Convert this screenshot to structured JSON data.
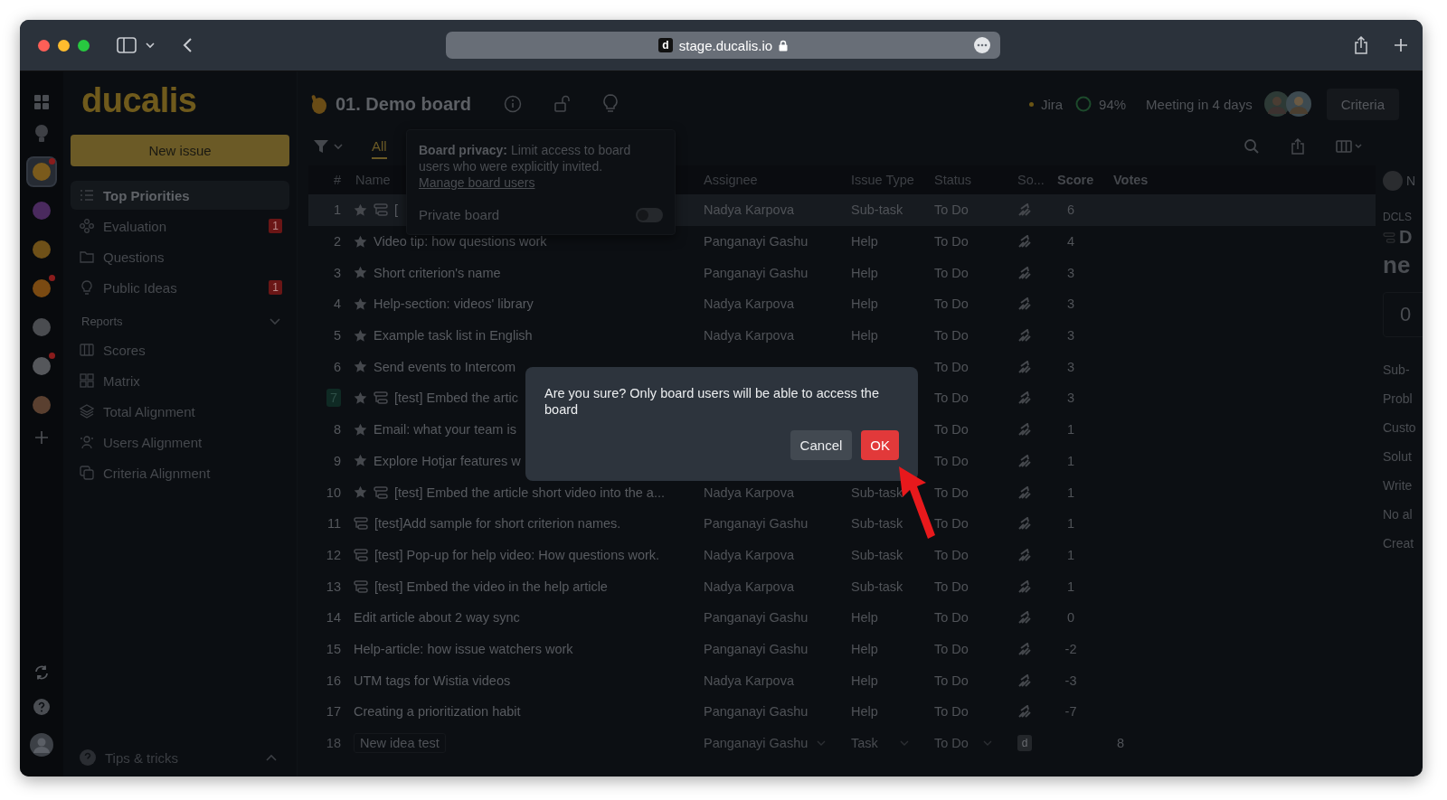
{
  "browser": {
    "url": "stage.ducalis.io",
    "favicon": "d"
  },
  "rail": {
    "boards": [
      {
        "kind": "hand",
        "selected": true,
        "notification": true
      },
      {
        "kind": "ball",
        "selected": false,
        "notification": false
      },
      {
        "kind": "writing",
        "selected": false,
        "notification": false
      },
      {
        "kind": "smiley",
        "selected": false,
        "notification": true
      },
      {
        "kind": "moon",
        "selected": false,
        "notification": false
      },
      {
        "kind": "clock",
        "selected": false,
        "notification": true
      },
      {
        "kind": "rocket",
        "selected": false,
        "notification": false
      }
    ]
  },
  "sidebar": {
    "logo": "ducalis",
    "new_issue": "New issue",
    "items": [
      {
        "label": "Top Priorities",
        "kind": "list",
        "selected": true
      },
      {
        "label": "Evaluation",
        "kind": "nodes",
        "badge": "1",
        "selected": false
      },
      {
        "label": "Questions",
        "kind": "folder",
        "selected": false
      },
      {
        "label": "Public Ideas",
        "kind": "bulb",
        "badge": "1",
        "selected": false
      }
    ],
    "reports": {
      "label": "Reports",
      "expanded": true,
      "items": [
        {
          "label": "Scores",
          "kind": "columns",
          "selected": false
        },
        {
          "label": "Matrix",
          "kind": "grid",
          "selected": false
        },
        {
          "label": "Total Alignment",
          "kind": "layers",
          "selected": false
        },
        {
          "label": "Users Alignment",
          "kind": "users",
          "selected": false
        },
        {
          "label": "Criteria Alignment",
          "kind": "copy",
          "selected": false
        }
      ]
    },
    "tips": {
      "label": "Tips & tricks",
      "expanded": false
    }
  },
  "header": {
    "title": "01. Demo board",
    "integration": "Jira",
    "progress": "94%",
    "meeting": "Meeting in 4 days",
    "criteria": "Criteria"
  },
  "filter_tabs": [
    {
      "label": "All",
      "selected": true
    }
  ],
  "popover": {
    "text": "**Board privacy:** Limit access to board users who were explicitly invited.",
    "link": "Manage board users",
    "toggle_label": "Private board",
    "on": false
  },
  "table": {
    "columns": [
      "#",
      "Name",
      "Assignee",
      "Issue Type",
      "Status",
      "So...",
      "Score",
      "Votes"
    ],
    "rows": [
      {
        "num": "1",
        "name": "[",
        "starred": true,
        "subtask": true,
        "assignee": "Nadya Karpova",
        "type": "Sub-task",
        "status": "To Do",
        "score": "6",
        "selected": true,
        "highlighted": false
      },
      {
        "num": "2",
        "name": "Video tip: how questions work",
        "starred": true,
        "subtask": false,
        "assignee": "Panganayi Gashu",
        "type": "Help",
        "status": "To Do",
        "score": "4",
        "selected": false,
        "highlighted": false
      },
      {
        "num": "3",
        "name": "Short criterion's name",
        "starred": true,
        "subtask": false,
        "assignee": "Panganayi Gashu",
        "type": "Help",
        "status": "To Do",
        "score": "3",
        "selected": false,
        "highlighted": false
      },
      {
        "num": "4",
        "name": "Help-section: videos' library",
        "starred": true,
        "subtask": false,
        "assignee": "Nadya Karpova",
        "type": "Help",
        "status": "To Do",
        "score": "3",
        "selected": false,
        "highlighted": false
      },
      {
        "num": "5",
        "name": "Example task list in English",
        "starred": true,
        "subtask": false,
        "assignee": "Nadya Karpova",
        "type": "Help",
        "status": "To Do",
        "score": "3",
        "selected": false,
        "highlighted": false
      },
      {
        "num": "6",
        "name": "Send events to Intercom",
        "starred": true,
        "subtask": false,
        "status": "To Do",
        "score": "3",
        "selected": false,
        "highlighted": false
      },
      {
        "num": "7",
        "name": "[test] Embed the artic",
        "starred": true,
        "subtask": true,
        "status": "To Do",
        "score": "3",
        "selected": false,
        "highlighted": true
      },
      {
        "num": "8",
        "name": "Email: what your team is",
        "starred": true,
        "subtask": false,
        "status": "To Do",
        "score": "1",
        "selected": false,
        "highlighted": false
      },
      {
        "num": "9",
        "name": "Explore Hotjar features w",
        "starred": true,
        "subtask": false,
        "status": "To Do",
        "score": "1",
        "selected": false,
        "highlighted": false
      },
      {
        "num": "10",
        "name": "[test] Embed the article short video into the a...",
        "starred": true,
        "subtask": true,
        "assignee": "Nadya Karpova",
        "type": "Sub-task",
        "status": "To Do",
        "score": "1",
        "selected": false,
        "highlighted": false
      },
      {
        "num": "11",
        "name": "[test]Add sample for short criterion names.",
        "starred": false,
        "subtask": true,
        "assignee": "Panganayi Gashu",
        "type": "Sub-task",
        "status": "To Do",
        "score": "1",
        "selected": false,
        "highlighted": false
      },
      {
        "num": "12",
        "name": "[test] Pop-up for help video: How questions work.",
        "starred": false,
        "subtask": true,
        "assignee": "Nadya Karpova",
        "type": "Sub-task",
        "status": "To Do",
        "score": "1",
        "selected": false,
        "highlighted": false
      },
      {
        "num": "13",
        "name": "[test] Embed the video in the help article",
        "starred": false,
        "subtask": true,
        "assignee": "Nadya Karpova",
        "type": "Sub-task",
        "status": "To Do",
        "score": "1",
        "selected": false,
        "highlighted": false
      },
      {
        "num": "14",
        "name": "Edit article about 2 way sync",
        "starred": false,
        "subtask": false,
        "assignee": "Panganayi Gashu",
        "type": "Help",
        "status": "To Do",
        "score": "0",
        "selected": false,
        "highlighted": false
      },
      {
        "num": "15",
        "name": "Help-article: how issue watchers work",
        "starred": false,
        "subtask": false,
        "assignee": "Panganayi Gashu",
        "type": "Help",
        "status": "To Do",
        "score": "-2",
        "selected": false,
        "highlighted": false
      },
      {
        "num": "16",
        "name": "UTM tags for Wistia videos",
        "starred": false,
        "subtask": false,
        "assignee": "Nadya Karpova",
        "type": "Help",
        "status": "To Do",
        "score": "-3",
        "selected": false,
        "highlighted": false
      },
      {
        "num": "17",
        "name": "Creating a prioritization habit",
        "starred": false,
        "subtask": false,
        "assignee": "Panganayi Gashu",
        "type": "Help",
        "status": "To Do",
        "score": "-7",
        "selected": false,
        "highlighted": false
      }
    ],
    "new_row": {
      "num": "18",
      "name": "New idea test",
      "assignee": "Panganayi Gashu",
      "type": "Task",
      "status": "To Do",
      "source": "d",
      "votes": "8"
    }
  },
  "side_panel": {
    "user": "N",
    "key": "DCLS",
    "title_start": "D",
    "title_next": "ne",
    "count": "0",
    "lines": [
      "Sub-",
      "Probl",
      "Custo",
      "Solut",
      "Write",
      "No al",
      "Creat"
    ]
  },
  "dialog": {
    "message": "Are you sure? Only board users will be able to access the board",
    "cancel": "Cancel",
    "ok": "OK"
  }
}
